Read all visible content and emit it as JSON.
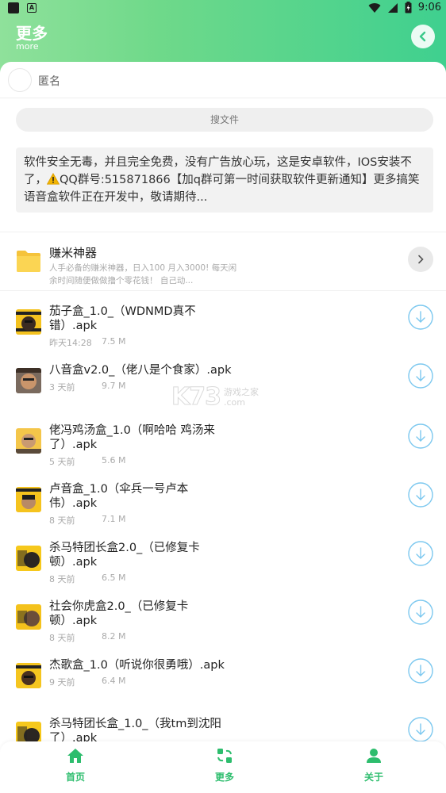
{
  "status_bar": {
    "time": "9:06",
    "icon_a_label": "A"
  },
  "header": {
    "title": "更多",
    "subtitle": "more"
  },
  "user": {
    "name": "匿名"
  },
  "search": {
    "placeholder": "搜文件"
  },
  "notice": {
    "text_before_icon": "软件安全无毒，并且完全免费，没有广告放心玩，这是安卓软件，IOS安装不了，",
    "text_after_icon": "QQ群号:515871866【加q群可第一时间获取软件更新通知】更多搞笑语音盒软件正在开发中，敬请期待..."
  },
  "folder": {
    "name": "赚米神器",
    "description": "人手必备的赚米神器，日入100 月入3000! 每天闲余时间随便做做撸个零花钱！ 自己动..."
  },
  "files": [
    {
      "name": "茄子盒_1.0_（WDNMD真不错）.apk",
      "date": "昨天14:28",
      "size": "7.5 M"
    },
    {
      "name": "八音盒v2.0_（佬八是个食家）.apk",
      "date": "3 天前",
      "size": "9.7 M"
    },
    {
      "name": "佬冯鸡汤盒_1.0（啊哈哈 鸡汤来了）.apk",
      "date": "5 天前",
      "size": "5.6 M"
    },
    {
      "name": "卢音盒_1.0（伞兵一号卢本伟）.apk",
      "date": "8 天前",
      "size": "7.1 M"
    },
    {
      "name": "杀马特团长盒2.0_（已修复卡顿）.apk",
      "date": "8 天前",
      "size": "6.5 M"
    },
    {
      "name": "社会你虎盒2.0_（已修复卡顿）.apk",
      "date": "8 天前",
      "size": "8.2 M"
    },
    {
      "name": "杰歌盒_1.0（听说你很勇哦）.apk",
      "date": "9 天前",
      "size": "6.4 M"
    },
    {
      "name": "杀马特团长盒_1.0_（我tm到沈阳了）.apk",
      "date": "",
      "size": ""
    }
  ],
  "watermark": {
    "brand": "K73",
    "line1": "游戏之家",
    "line2": ".com"
  },
  "bottom_nav": [
    {
      "label": "首页",
      "icon": "home-icon"
    },
    {
      "label": "更多",
      "icon": "more-icon"
    },
    {
      "label": "关于",
      "icon": "user-icon"
    }
  ],
  "colors": {
    "accent": "#2dbd6d",
    "header_start": "#8fe19b",
    "header_end": "#3fd08f",
    "download": "#7cc8ef"
  }
}
